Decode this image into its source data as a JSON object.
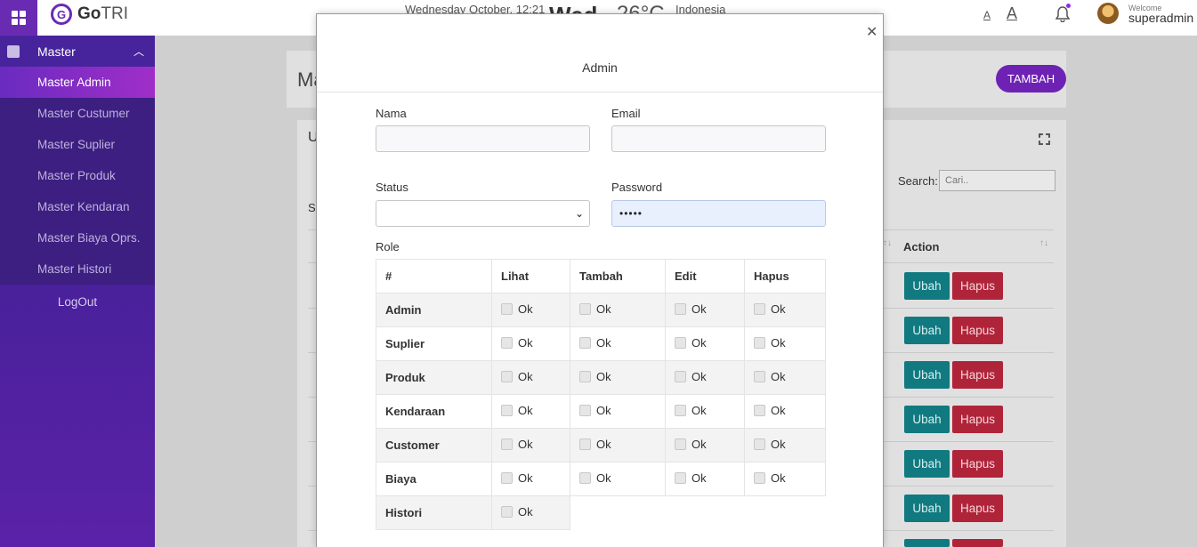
{
  "topbar": {
    "app_name_bold": "Go",
    "app_name_light": "TRI",
    "logo_letter": "G",
    "date": "Wednesday October, 12:21",
    "day_short": "Wed",
    "temperature": "26°C",
    "location": "Indonesia",
    "font_small_label": "A",
    "font_large_label": "A",
    "welcome_label": "Welcome",
    "username": "superadmin"
  },
  "sidebar": {
    "section_label": "Master",
    "items": [
      {
        "label": "Master Admin",
        "active": true
      },
      {
        "label": "Master Custumer",
        "active": false
      },
      {
        "label": "Master Suplier",
        "active": false
      },
      {
        "label": "Master Produk",
        "active": false
      },
      {
        "label": "Master Kendaran",
        "active": false
      },
      {
        "label": "Master Biaya Oprs.",
        "active": false
      },
      {
        "label": "Master Histori",
        "active": false
      }
    ],
    "logout_label": "LogOut"
  },
  "page": {
    "title_partial": "Ma",
    "add_button": "TAMBAH",
    "card_title_partial": "U",
    "show_partial": "Sh",
    "search_label": "Search:",
    "search_placeholder": "Cari..",
    "action_header": "Action",
    "row_buttons": {
      "edit": "Ubah",
      "delete": "Hapus"
    }
  },
  "modal": {
    "title": "Admin",
    "fields": {
      "nama_label": "Nama",
      "nama_value": "",
      "email_label": "Email",
      "email_value": "",
      "status_label": "Status",
      "status_value": "",
      "password_label": "Password",
      "password_value": "•••••",
      "role_label": "Role"
    },
    "role_table": {
      "headers": [
        "#",
        "Lihat",
        "Tambah",
        "Edit",
        "Hapus"
      ],
      "checkbox_label": "Ok",
      "rows": [
        {
          "name": "Admin",
          "cells": 4
        },
        {
          "name": "Suplier",
          "cells": 4
        },
        {
          "name": "Produk",
          "cells": 4
        },
        {
          "name": "Kendaraan",
          "cells": 4
        },
        {
          "name": "Customer",
          "cells": 4
        },
        {
          "name": "Biaya",
          "cells": 4
        },
        {
          "name": "Histori",
          "cells": 1
        }
      ]
    }
  },
  "colors": {
    "brand": "#6a2bb3",
    "accent_purple": "#6e22b4",
    "edit_button": "#117a80",
    "delete_button": "#b0243a"
  }
}
